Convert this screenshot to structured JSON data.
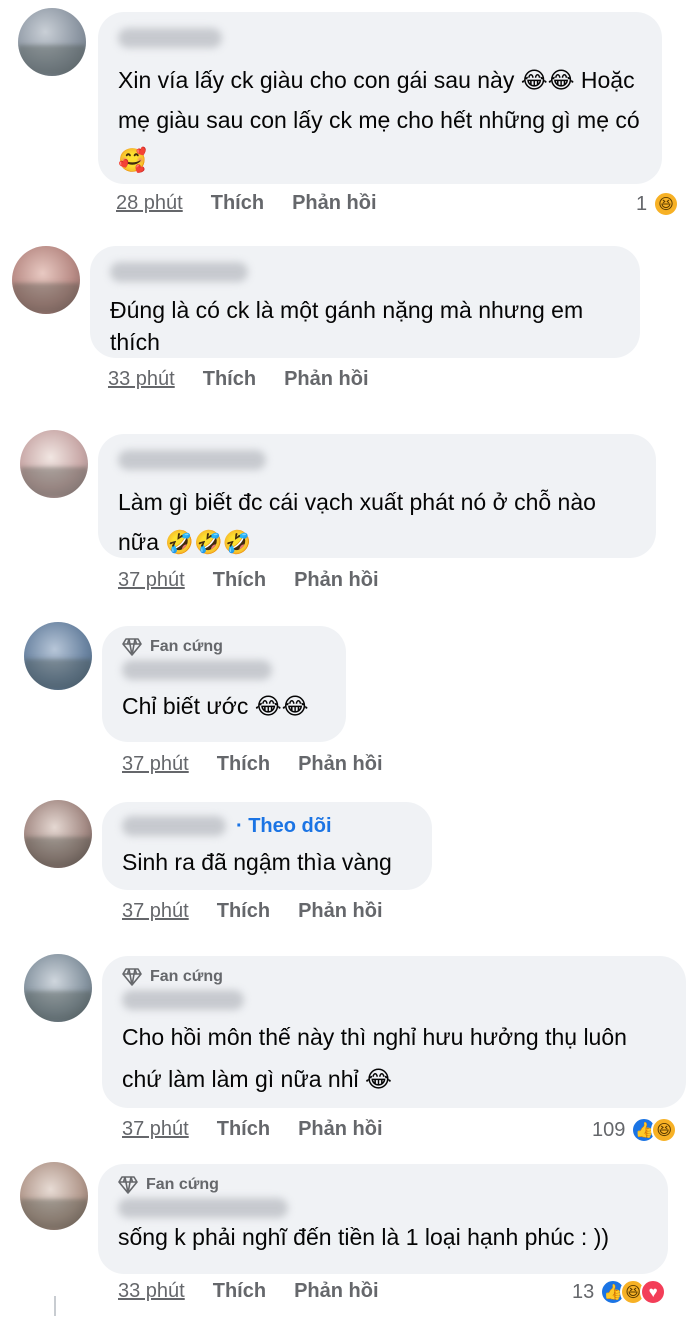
{
  "comments": [
    {
      "text": "Xin vía lấy ck giàu cho con gái sau này 😂😂 Hoặc mẹ giàu sau con lấy ck mẹ cho hết những gì mẹ có 🥰",
      "time": "28 phút",
      "like": "Thích",
      "reply": "Phản hồi",
      "reaction_count": "1",
      "reactions": [
        "haha"
      ]
    },
    {
      "text": "Đúng là có ck là một gánh nặng mà nhưng em thích",
      "time": "33 phút",
      "like": "Thích",
      "reply": "Phản hồi"
    },
    {
      "text": "Làm gì biết đc cái vạch xuất phát nó ở chỗ nào nữa 🤣🤣🤣",
      "time": "37 phút",
      "like": "Thích",
      "reply": "Phản hồi"
    },
    {
      "badge": "Fan cứng",
      "text": "Chỉ biết ước 😂😂",
      "time": "37 phút",
      "like": "Thích",
      "reply": "Phản hồi"
    },
    {
      "follow": "· Theo dõi",
      "text": "Sinh ra đã ngậm thìa vàng",
      "time": "37 phút",
      "like": "Thích",
      "reply": "Phản hồi"
    },
    {
      "badge": "Fan cứng",
      "text": "Cho hồi môn thế này thì nghỉ hưu hưởng thụ luôn chứ làm làm gì nữa nhỉ 😂",
      "time": "37 phút",
      "like": "Thích",
      "reply": "Phản hồi",
      "reaction_count": "109",
      "reactions": [
        "like",
        "haha"
      ]
    },
    {
      "badge": "Fan cứng",
      "text": "sống k phải nghĩ đến tiền là 1 loại hạnh phúc : ))",
      "time": "33 phút",
      "like": "Thích",
      "reply": "Phản hồi",
      "reaction_count": "13",
      "reactions": [
        "like",
        "haha",
        "love"
      ]
    }
  ],
  "colors": {
    "bubble": "#f0f2f5",
    "meta": "#65676b",
    "link": "#1b74e4",
    "text": "#050505"
  },
  "icons": {
    "badge": "diamond-icon",
    "like": "like-reaction-icon",
    "haha": "haha-reaction-icon",
    "love": "love-reaction-icon"
  }
}
